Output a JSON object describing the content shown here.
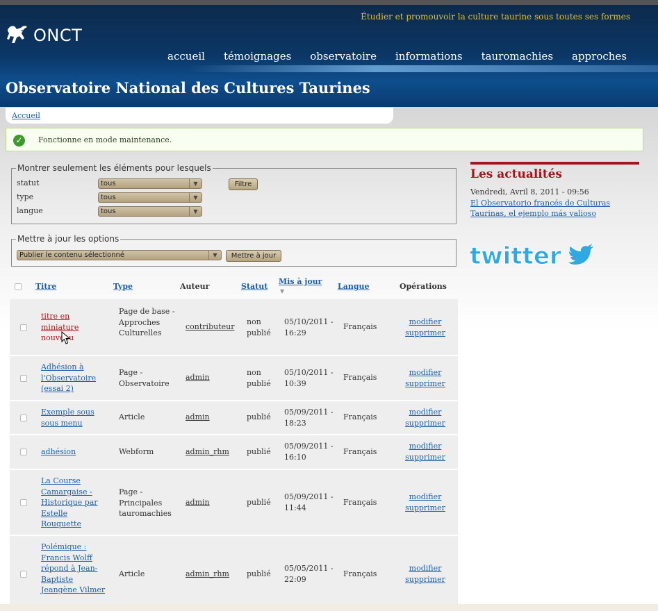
{
  "header": {
    "tagline": "Étudier et promouvoir la culture taurine sous toutes ses formes",
    "logo_text": "ONCT",
    "site_name": "Observatoire National des Cultures Taurines",
    "nav": [
      "accueil",
      "témoignages",
      "observatoire",
      "informations",
      "tauromachies",
      "approches"
    ]
  },
  "breadcrumb": {
    "home": "Accueil"
  },
  "status_message": "Fonctionne en mode maintenance.",
  "filter": {
    "legend": "Montrer seulement les éléments pour lesquels",
    "fields": [
      {
        "label": "statut",
        "value": "tous"
      },
      {
        "label": "type",
        "value": "tous"
      },
      {
        "label": "langue",
        "value": "tous"
      }
    ],
    "button": "Filtre"
  },
  "update": {
    "legend": "Mettre à jour les options",
    "select_value": "Publier le contenu sélectionné",
    "button": "Mettre à jour"
  },
  "table": {
    "headers": {
      "title": "Titre",
      "type": "Type",
      "author": "Auteur",
      "status": "Statut",
      "updated": "Mis à jour",
      "language": "Langue",
      "operations": "Opérations"
    },
    "edit_label": "modifier",
    "delete_label": "supprimer",
    "rows": [
      {
        "title": "titre en miniature",
        "badge": "nouveau",
        "type": "Page de base - Approches Culturelles",
        "author": "contributeur",
        "status": "non publié",
        "date": "05/10/2011 - 16:29",
        "language": "Français"
      },
      {
        "title": "Adhésion à l'Observatoire (essai 2)",
        "type": "Page - Observatoire",
        "author": "admin",
        "status": "non publié",
        "date": "05/10/2011 - 10:39",
        "language": "Français"
      },
      {
        "title": "Exemple sous sous menu",
        "type": "Article",
        "author": "admin",
        "status": "publié",
        "date": "05/09/2011 - 18:23",
        "language": "Français"
      },
      {
        "title": "adhésion",
        "type": "Webform",
        "author": "admin_rhm",
        "status": "publié",
        "date": "05/09/2011 - 16:10",
        "language": "Français"
      },
      {
        "title": "La Course Camargaise - Historique par Estelle Rouquette",
        "type": "Page - Principales tauromachies",
        "author": "admin",
        "status": "publié",
        "date": "05/09/2011 - 11:44",
        "language": "Français"
      },
      {
        "title": "Polémique : Francis Wolff répond à Jean-Baptiste Jeangène Vilmer",
        "type": "Article",
        "author": "admin_rhm",
        "status": "publié",
        "date": "05/05/2011 - 22:09",
        "language": "Français"
      }
    ]
  },
  "news": {
    "title": "Les actualités",
    "date": "Vendredi, Avril 8, 2011 - 09:56",
    "link": "El Observatorio francés de Culturas Taurinas, el ejemplo más valioso"
  },
  "twitter": {
    "text": "twitter"
  },
  "colors": {
    "accent_red": "#a4141a",
    "link_blue": "#1c5fa8",
    "header_blue": "#0b3766",
    "tagline_gold": "#e3c11e"
  }
}
